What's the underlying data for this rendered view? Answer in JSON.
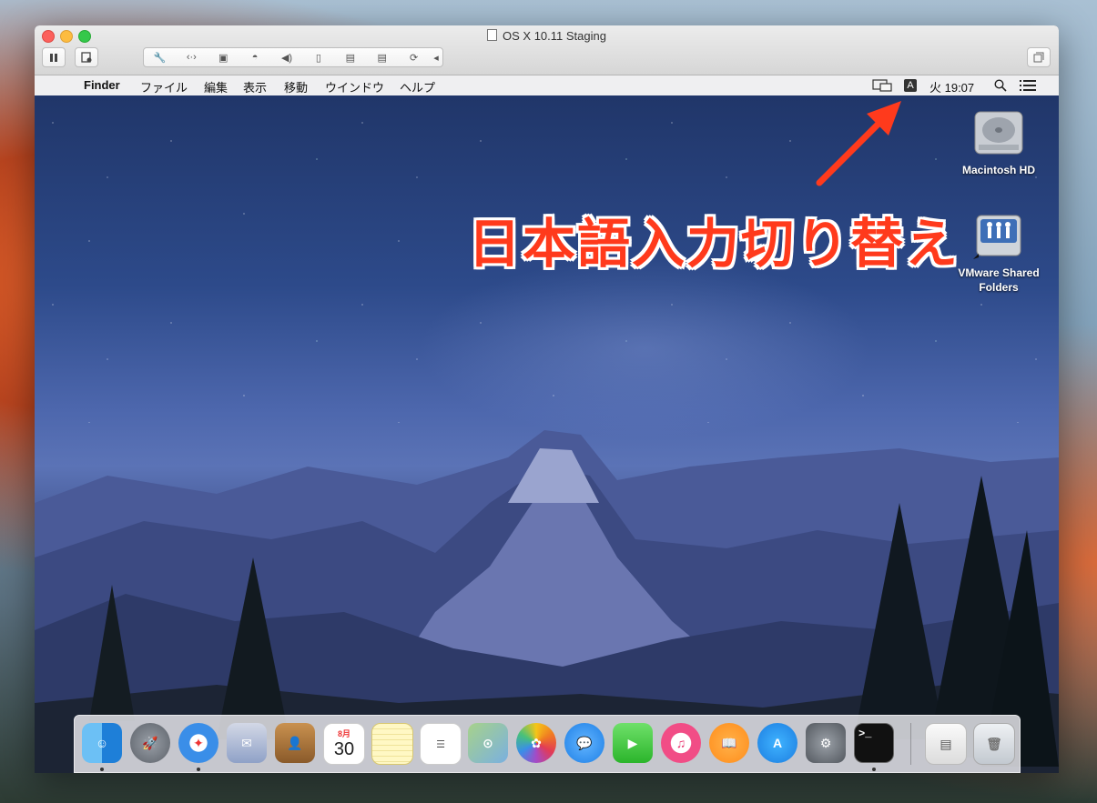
{
  "window": {
    "title": "OS X 10.11 Staging",
    "toolbar": {
      "pause_icon": "pause-icon",
      "snapshot_icon": "snapshot-icon",
      "device_icons": [
        "wrench-icon",
        "network-icon",
        "disk-icon",
        "camera-icon",
        "sound-icon",
        "mouse-icon",
        "usb-icon",
        "usb-icon",
        "sync-icon",
        "collapse-arrow-icon"
      ],
      "fullscreen_icon": "fullscreen-icon"
    }
  },
  "menubar": {
    "apple_glyph": "",
    "items": [
      "Finder",
      "ファイル",
      "編集",
      "表示",
      "移動",
      "ウインドウ",
      "ヘルプ"
    ],
    "input_badge": "A",
    "clock": "火 19:07",
    "status_icons": [
      "display-icon",
      "search-icon",
      "list-icon"
    ]
  },
  "annotation": {
    "callout": "日本語入力切り替え",
    "arrow_color": "#ff3a1c"
  },
  "desktop": {
    "icons": [
      {
        "label": "Macintosh HD",
        "icon": "hard-drive-icon"
      },
      {
        "label": "VMware Shared Folders",
        "icon": "shared-folder-icon"
      }
    ]
  },
  "dock": {
    "items": [
      {
        "name": "Finder",
        "icon": "finder-icon",
        "running": true
      },
      {
        "name": "Launchpad",
        "icon": "rocket-icon",
        "running": false
      },
      {
        "name": "Safari",
        "icon": "compass-icon",
        "running": true
      },
      {
        "name": "Mail",
        "icon": "stamp-icon",
        "running": false
      },
      {
        "name": "Contacts",
        "icon": "contacts-icon",
        "running": false
      },
      {
        "name": "Calendar",
        "icon": "calendar-icon",
        "running": false,
        "month": "8月",
        "day": "30"
      },
      {
        "name": "Notes",
        "icon": "notes-icon",
        "running": false
      },
      {
        "name": "Reminders",
        "icon": "reminders-icon",
        "running": false
      },
      {
        "name": "Maps",
        "icon": "map-icon",
        "running": false
      },
      {
        "name": "Photos",
        "icon": "flower-icon",
        "running": false
      },
      {
        "name": "Messages",
        "icon": "chat-bubble-icon",
        "running": false
      },
      {
        "name": "FaceTime",
        "icon": "video-camera-icon",
        "running": false
      },
      {
        "name": "iTunes",
        "icon": "music-note-icon",
        "running": false
      },
      {
        "name": "iBooks",
        "icon": "book-icon",
        "running": false
      },
      {
        "name": "App Store",
        "icon": "appstore-icon",
        "running": false
      },
      {
        "name": "System Preferences",
        "icon": "gear-icon",
        "running": false
      },
      {
        "name": "Terminal",
        "icon": "terminal-icon",
        "running": true,
        "glyph": ">_"
      },
      {
        "name": "Documents",
        "icon": "file-icon",
        "running": false
      },
      {
        "name": "Trash",
        "icon": "trash-icon",
        "running": false
      }
    ]
  }
}
